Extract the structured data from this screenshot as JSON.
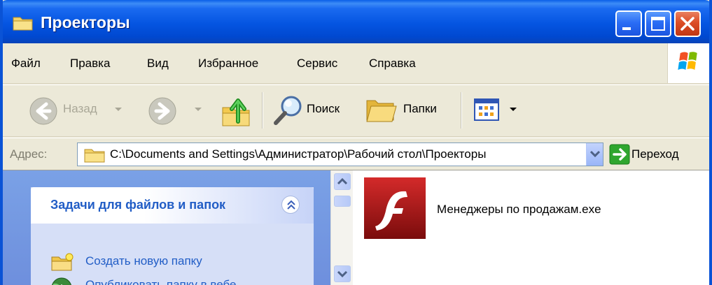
{
  "window": {
    "title": "Проекторы"
  },
  "menu": {
    "items": [
      "Файл",
      "Правка",
      "Вид",
      "Избранное",
      "Сервис",
      "Справка"
    ]
  },
  "toolbar": {
    "back_label": "Назад",
    "search_label": "Поиск",
    "folders_label": "Папки"
  },
  "address": {
    "label": "Адрес:",
    "path": "C:\\Documents and Settings\\Администратор\\Рабочий стол\\Проекторы",
    "go_label": "Переход"
  },
  "taskpane": {
    "title": "Задачи для файлов и папок",
    "links": [
      "Создать новую папку",
      "Опубликовать папку в вебе"
    ]
  },
  "files": [
    {
      "name": "Менеджеры по продажам.exe",
      "icon": "flash-icon"
    }
  ],
  "colors": {
    "titlebar": "#0555e1",
    "close_button": "#dc4d26",
    "link": "#215dc6",
    "taskpane_bg": "#7aa1e6"
  }
}
